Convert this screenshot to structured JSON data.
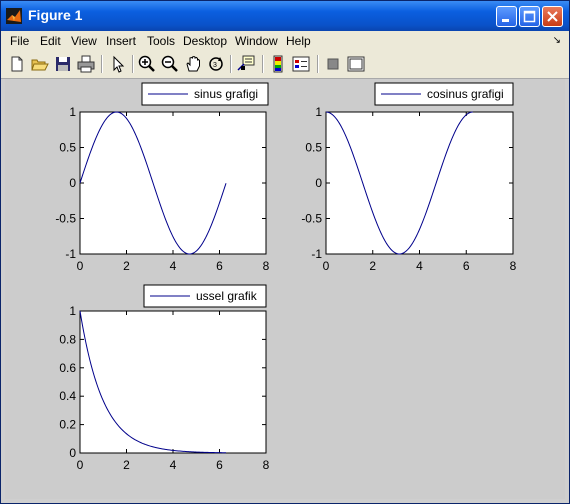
{
  "window": {
    "title": "Figure 1"
  },
  "menu": [
    "File",
    "Edit",
    "View",
    "Insert",
    "Tools",
    "Desktop",
    "Window",
    "Help"
  ],
  "colors": {
    "line": "#00008b",
    "figure_bg": "#cccccc",
    "titlebar": "#0a52c9"
  },
  "toolbar_icons": [
    "new-file-icon",
    "open-folder-icon",
    "save-icon",
    "print-icon",
    "select-arrow-icon",
    "zoom-in-icon",
    "zoom-out-icon",
    "pan-hand-icon",
    "rotate-3d-icon",
    "data-cursor-icon",
    "colorbar-icon",
    "legend-icon",
    "hide-plot-tools-icon",
    "show-plot-tools-icon"
  ],
  "chart_data": [
    {
      "type": "line",
      "legend": "sinus grafigi",
      "function": "sin(x)",
      "x_range": [
        0,
        6.28
      ],
      "xlim": [
        0,
        8
      ],
      "ylim": [
        -1,
        1
      ],
      "xticks": [
        "0",
        "2",
        "4",
        "6",
        "8"
      ],
      "yticks": [
        "1",
        "0.5",
        "0",
        "-0.5",
        "-1"
      ]
    },
    {
      "type": "line",
      "legend": "cosinus grafigi",
      "function": "cos(x)",
      "x_range": [
        0,
        6.28
      ],
      "xlim": [
        0,
        8
      ],
      "ylim": [
        -1,
        1
      ],
      "xticks": [
        "0",
        "2",
        "4",
        "6",
        "8"
      ],
      "yticks": [
        "1",
        "0.5",
        "0",
        "-0.5",
        "-1"
      ]
    },
    {
      "type": "line",
      "legend": "ussel grafik",
      "function": "exp(-x)",
      "x_range": [
        0,
        6.28
      ],
      "xlim": [
        0,
        8
      ],
      "ylim": [
        0,
        1
      ],
      "xticks": [
        "0",
        "2",
        "4",
        "6",
        "8"
      ],
      "yticks": [
        "1",
        "0.8",
        "0.6",
        "0.4",
        "0.2",
        "0"
      ]
    }
  ]
}
